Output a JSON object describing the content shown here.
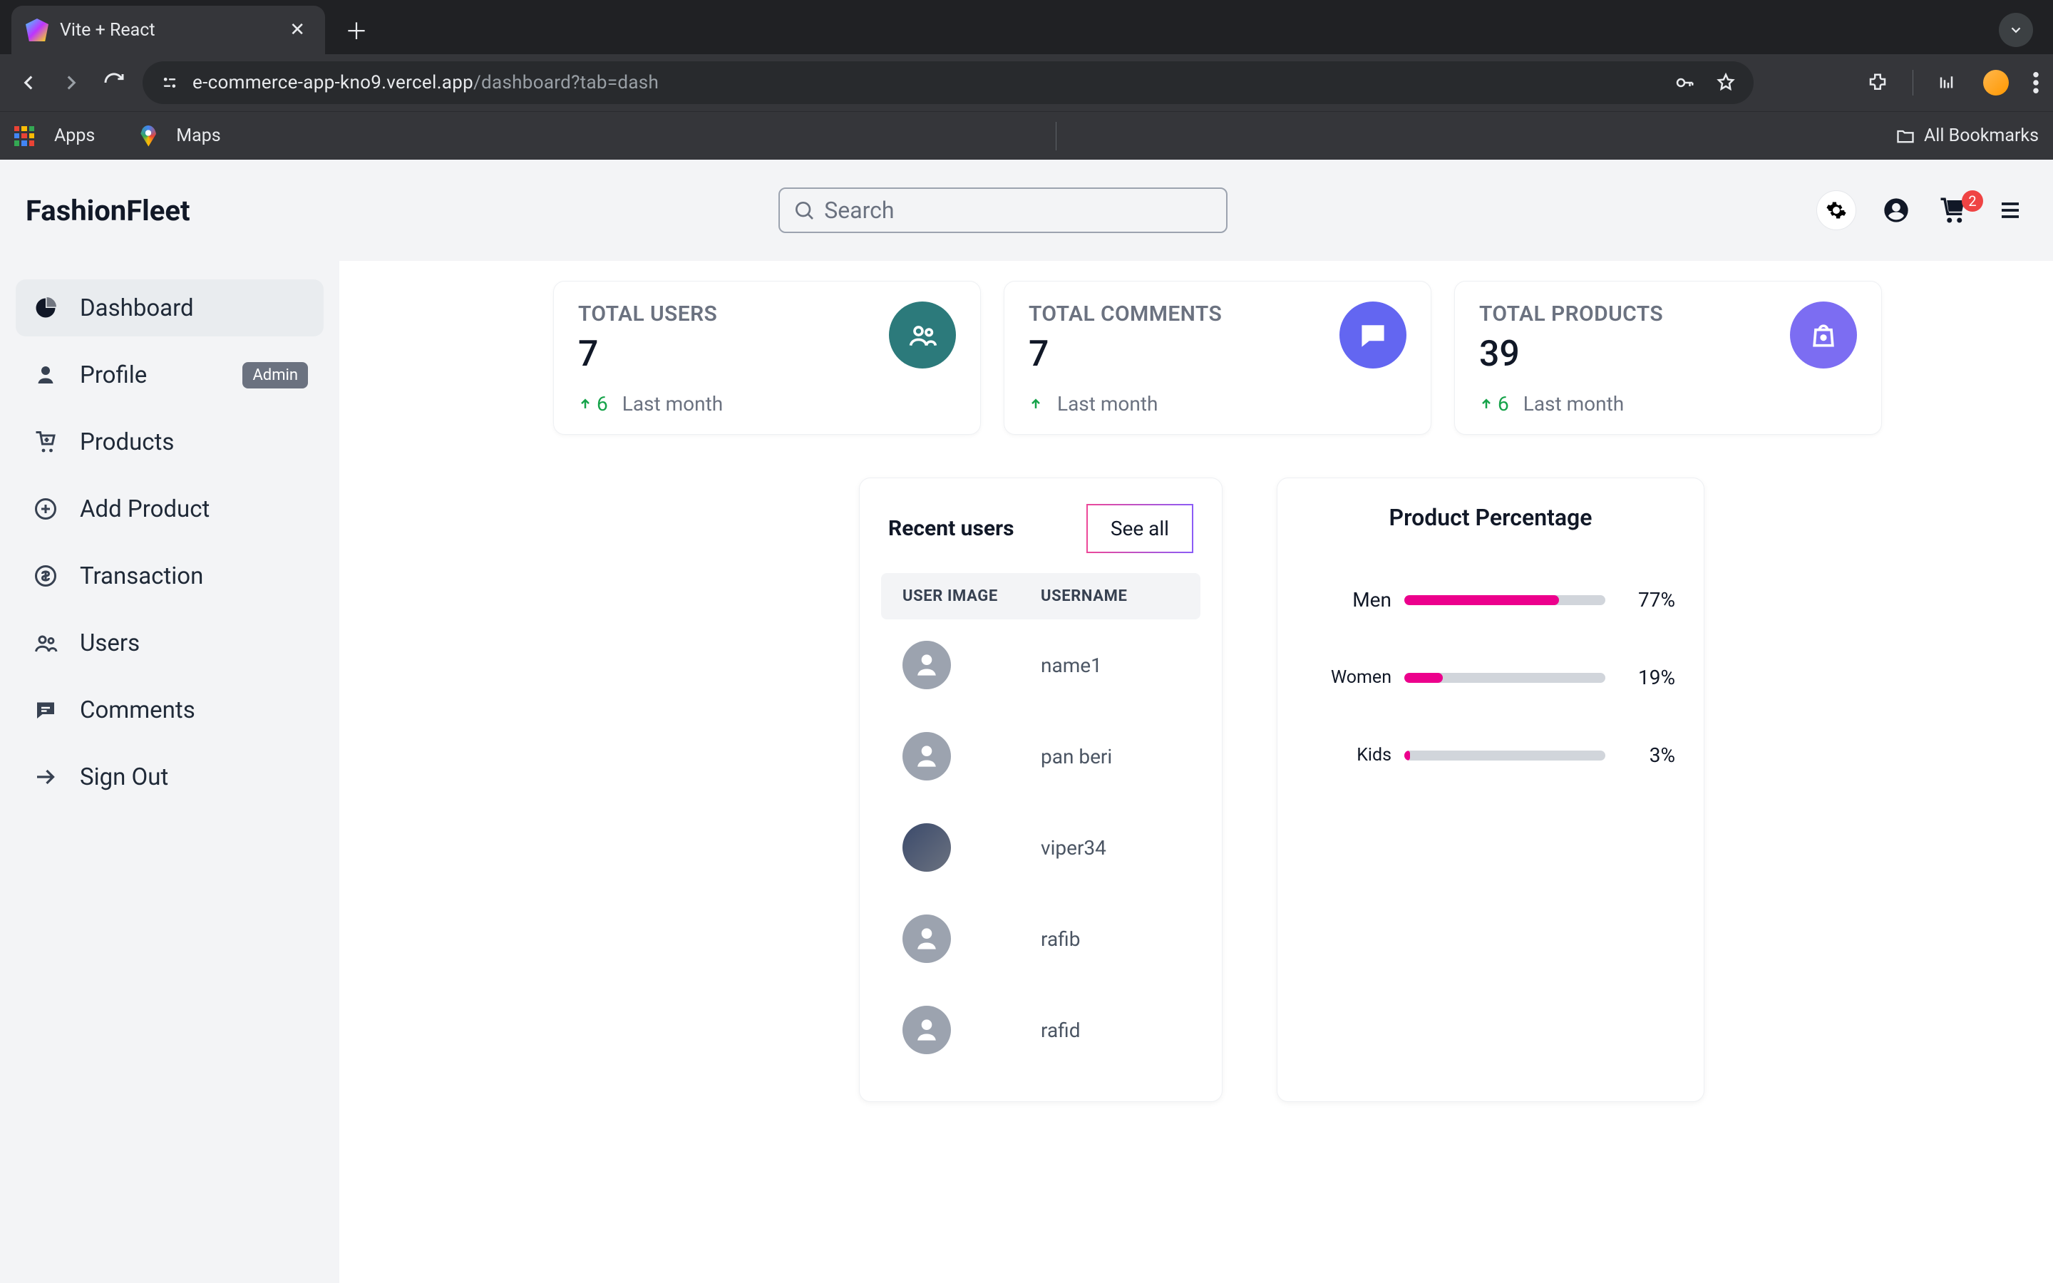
{
  "browser": {
    "tab_title": "Vite + React",
    "url_host": "e-commerce-app-kno9.vercel.app",
    "url_path": "/dashboard?tab=dash",
    "bookmarks": {
      "apps": "Apps",
      "maps": "Maps",
      "all": "All Bookmarks"
    }
  },
  "header": {
    "brand": "FashionFleet",
    "search_placeholder": "Search",
    "cart_count": "2"
  },
  "sidebar": {
    "items": [
      {
        "label": "Dashboard",
        "icon": "chart-pie",
        "active": true
      },
      {
        "label": "Profile",
        "icon": "user",
        "badge": "Admin"
      },
      {
        "label": "Products",
        "icon": "cart-plus"
      },
      {
        "label": "Add Product",
        "icon": "plus-circle"
      },
      {
        "label": "Transaction",
        "icon": "dollar-circle"
      },
      {
        "label": "Users",
        "icon": "users-group"
      },
      {
        "label": "Comments",
        "icon": "comment"
      },
      {
        "label": "Sign Out",
        "icon": "arrow-right"
      }
    ]
  },
  "stats": [
    {
      "label": "TOTAL USERS",
      "value": "7",
      "delta": "6",
      "foot": "Last month",
      "color": "c-teal",
      "icon": "users-group"
    },
    {
      "label": "TOTAL COMMENTS",
      "value": "7",
      "delta": "",
      "foot": "Last month",
      "color": "c-indigo",
      "icon": "comment"
    },
    {
      "label": "TOTAL PRODUCTS",
      "value": "39",
      "delta": "6",
      "foot": "Last month",
      "color": "c-violet",
      "icon": "bag"
    }
  ],
  "recent": {
    "title": "Recent users",
    "see_all": "See all",
    "cols": [
      "USER IMAGE",
      "USERNAME"
    ],
    "rows": [
      {
        "name": "name1",
        "photo": false
      },
      {
        "name": "pan beri",
        "photo": false
      },
      {
        "name": "viper34",
        "photo": true
      },
      {
        "name": "rafib",
        "photo": false
      },
      {
        "name": "rafid",
        "photo": false
      }
    ]
  },
  "chart_data": {
    "type": "bar",
    "title": "Product Percentage",
    "categories": [
      "Men",
      "Women",
      "Kids"
    ],
    "values": [
      77,
      19,
      3
    ],
    "unit": "%",
    "xlim": [
      0,
      100
    ]
  }
}
